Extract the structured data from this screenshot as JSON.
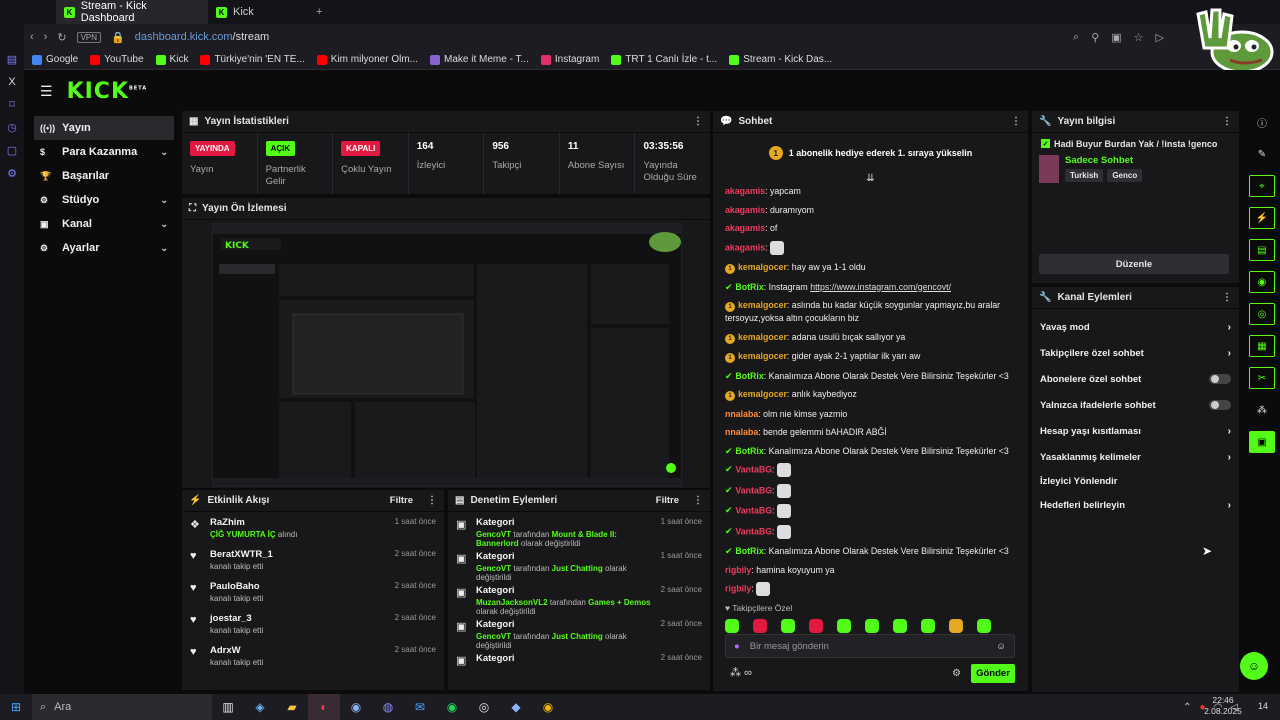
{
  "browser": {
    "tabs": [
      {
        "label": "Stream - Kick Dashboard",
        "active": true
      },
      {
        "label": "Kick",
        "active": false
      }
    ],
    "url_domain": "dashboard.kick.com",
    "url_path": "/stream",
    "vpn": "VPN",
    "bookmarks": [
      "Google",
      "YouTube",
      "Kick",
      "Türkiye'nin 'EN TE...",
      "Kim milyoner Olm...",
      "Make it Meme - T...",
      "Instagram",
      "TRT 1 Canlı İzle - t...",
      "Stream - Kick Das..."
    ]
  },
  "brand": {
    "logo": "KICK",
    "beta": "BETA",
    "accent": "#53fc18"
  },
  "nav": {
    "items": [
      {
        "label": "Yayın",
        "icon": "broadcast-icon",
        "chevron": false
      },
      {
        "label": "Para Kazanma",
        "icon": "money-icon",
        "chevron": true
      },
      {
        "label": "Başarılar",
        "icon": "trophy-icon",
        "chevron": false
      },
      {
        "label": "Stüdyo",
        "icon": "studio-icon",
        "chevron": true
      },
      {
        "label": "Kanal",
        "icon": "channel-icon",
        "chevron": true
      },
      {
        "label": "Ayarlar",
        "icon": "gear-icon",
        "chevron": true
      }
    ]
  },
  "stats": {
    "title": "Yayın İstatistikleri",
    "items": [
      {
        "badge": "YAYINDA",
        "badge_color": "#e3193f",
        "label": "Yayın"
      },
      {
        "badge": "AÇIK",
        "badge_color": "#53fc18",
        "label": "Partnerlik Gelir"
      },
      {
        "badge": "KAPALI",
        "badge_color": "#e3193f",
        "label": "Çoklu Yayın"
      },
      {
        "value": "164",
        "label": "İzleyici"
      },
      {
        "value": "956",
        "label": "Takipçi"
      },
      {
        "value": "11",
        "label": "Abone Sayısı"
      },
      {
        "value": "03:35:56",
        "label": "Yayında Olduğu Süre"
      }
    ]
  },
  "preview": {
    "title": "Yayın Ön İzlemesi"
  },
  "activity": {
    "title": "Etkinlik Akışı",
    "filter": "Filtre",
    "items": [
      {
        "name": "RaZhim",
        "sub_green": "ÇİĞ YUMURTA İÇ",
        "sub": "alındı",
        "time": "1 saat önce",
        "icon": "gift-icon"
      },
      {
        "name": "BeratXWTR_1",
        "sub": "kanalı takip etti",
        "time": "2 saat önce",
        "icon": "heart-icon"
      },
      {
        "name": "PauloBaho",
        "sub": "kanalı takip etti",
        "time": "2 saat önce",
        "icon": "heart-icon"
      },
      {
        "name": "joestar_3",
        "sub": "kanalı takip etti",
        "time": "2 saat önce",
        "icon": "heart-icon"
      },
      {
        "name": "AdrxW",
        "sub": "kanalı takip etti",
        "time": "2 saat önce",
        "icon": "heart-icon"
      }
    ]
  },
  "mod": {
    "title": "Denetim Eylemleri",
    "filter": "Filtre",
    "items": [
      {
        "title": "Kategori",
        "user": "GencoVT",
        "mid": "tarafından",
        "target": "Mount & Blade II: Bannerlord",
        "end": "olarak değiştirildi",
        "time": "1 saat önce"
      },
      {
        "title": "Kategori",
        "user": "GencoVT",
        "mid": "tarafından",
        "target": "Just Chatting",
        "end": "olarak değiştirildi",
        "time": "1 saat önce"
      },
      {
        "title": "Kategori",
        "user": "MuzanJacksonVL2",
        "mid": "tarafından",
        "target": "Games + Demos",
        "end": "olarak değiştirildi",
        "time": "2 saat önce"
      },
      {
        "title": "Kategori",
        "user": "GencoVT",
        "mid": "tarafından",
        "target": "Just Chatting",
        "end": "olarak değiştirildi",
        "time": "2 saat önce"
      },
      {
        "title": "Kategori",
        "user": "",
        "mid": "",
        "target": "",
        "end": "",
        "time": "2 saat önce"
      }
    ]
  },
  "chat": {
    "title": "Sohbet",
    "pinned": "1 abonelik hediye ederek 1. sıraya yükselin",
    "pinned_count": "1",
    "messages": [
      {
        "user": "akagamis",
        "color": "red",
        "text": "yapcam"
      },
      {
        "user": "akagamis",
        "color": "red",
        "text": "duramıyom"
      },
      {
        "user": "akagamis",
        "color": "red",
        "text": "of"
      },
      {
        "user": "akagamis",
        "color": "red",
        "text": "",
        "emote": true
      },
      {
        "user": "kemalgocer",
        "color": "ylw",
        "text": "hay aw ya 1-1 oldu",
        "badge": "coin"
      },
      {
        "user": "BotRix",
        "color": "grn",
        "text": "Instagram",
        "link": "https://www.instagram.com/gencovt/",
        "badge": "bot"
      },
      {
        "user": "kemalgocer",
        "color": "ylw",
        "text": "aslında bu kadar küçük soygunlar yapmayız,bu aralar tersoyuz,yoksa altın çocukların biz",
        "badge": "coin"
      },
      {
        "user": "kemalgocer",
        "color": "ylw",
        "text": "adana usulü bıçak sallıyor ya",
        "badge": "coin"
      },
      {
        "user": "kemalgocer",
        "color": "ylw",
        "text": "gider ayak 2-1 yaptılar ilk yarı aw",
        "badge": "coin"
      },
      {
        "user": "BotRix",
        "color": "grn",
        "text": "Kanalımıza Abone Olarak Destek Vere Bilirsiniz Teşekürler <3",
        "badge": "bot"
      },
      {
        "user": "kemalgocer",
        "color": "ylw",
        "text": "anlık kaybediyoz",
        "badge": "coin"
      },
      {
        "user": "nnalaba",
        "color": "org",
        "text": "olm nie kimse yazmio"
      },
      {
        "user": "nnalaba",
        "color": "org",
        "text": "bende gelemmi bAHADIR ABĞİ"
      },
      {
        "user": "BotRix",
        "color": "grn",
        "text": "Kanalımıza Abone Olarak Destek Vere Bilirsiniz Teşekürler <3",
        "badge": "bot"
      },
      {
        "user": "VantaBG",
        "color": "red",
        "text": "",
        "emote": true,
        "badge": "bot"
      },
      {
        "user": "VantaBG",
        "color": "red",
        "text": "",
        "emote": true,
        "badge": "bot"
      },
      {
        "user": "VantaBG",
        "color": "red",
        "text": "",
        "emote": true,
        "badge": "bot"
      },
      {
        "user": "VantaBG",
        "color": "red",
        "text": "",
        "emote": true,
        "badge": "bot"
      },
      {
        "user": "BotRix",
        "color": "grn",
        "text": "Kanalımıza Abone Olarak Destek Vere Bilirsiniz Teşekürler <3",
        "badge": "bot"
      },
      {
        "user": "rigbily",
        "color": "red",
        "text": "hamina koyuyum ya"
      },
      {
        "user": "rigbily",
        "color": "red",
        "text": "",
        "emote": true
      }
    ],
    "followers_only": "Takipçilere Özel",
    "placeholder": "Bir mesaj gönderin",
    "send": "Gönder",
    "infinity": "∞"
  },
  "info": {
    "title": "Yayın bilgisi",
    "stream_title": "Hadi Buyur Burdan Yak / !insta !genco",
    "category": "Sadece Sohbet",
    "tags": [
      "Turkish",
      "Genco"
    ],
    "edit": "Düzenle"
  },
  "actions": {
    "title": "Kanal Eylemleri",
    "items": [
      {
        "label": "Yavaş mod",
        "kind": "chevron"
      },
      {
        "label": "Takipçilere özel sohbet",
        "kind": "chevron"
      },
      {
        "label": "Abonelere özel sohbet",
        "kind": "toggle"
      },
      {
        "label": "Yalnızca ifadelerle sohbet",
        "kind": "toggle"
      },
      {
        "label": "Hesap yaşı kısıtlaması",
        "kind": "chevron"
      },
      {
        "label": "Yasaklanmış kelimeler",
        "kind": "chevron"
      },
      {
        "label": "İzleyici Yönlendir",
        "kind": "none"
      },
      {
        "label": "Hedefleri belirleyin",
        "kind": "chevron"
      }
    ]
  },
  "taskbar": {
    "search": "Ara",
    "time": "22:46",
    "date": "2.08.2025",
    "badge_count": "14"
  }
}
